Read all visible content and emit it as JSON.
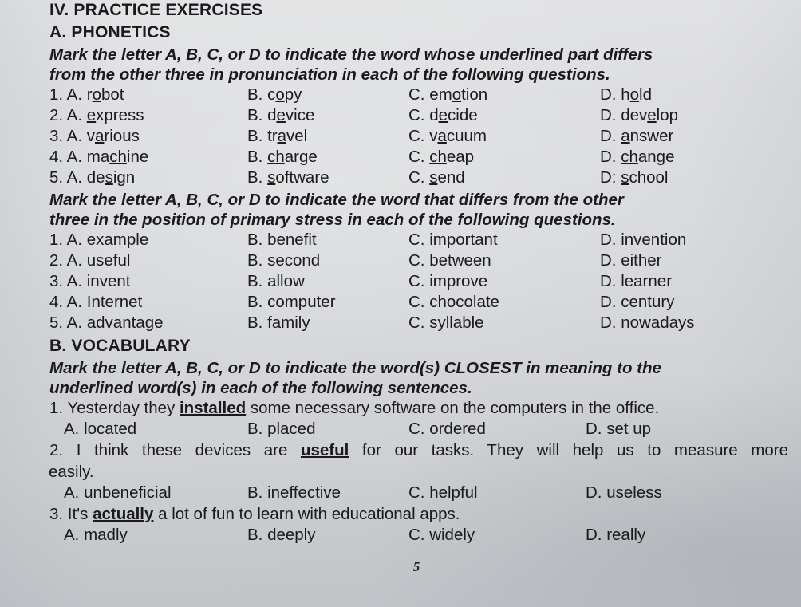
{
  "section": {
    "number_title": "IV. PRACTICE EXERCISES",
    "part_a": "A. PHONETICS",
    "part_b": "B. VOCABULARY"
  },
  "instructions": {
    "pronunciation": {
      "line1": "Mark the letter A, B, C, or D to indicate the word whose underlined part differs",
      "line2": "from the other three in pronunciation in each of the following questions."
    },
    "stress": {
      "line1": "Mark the letter A, B, C, or D to indicate the word that differs from the other",
      "line2": "three in the position of primary stress in each of the following questions."
    },
    "vocabulary": {
      "line1": "Mark the letter A, B, C, or D to indicate the word(s) CLOSEST in meaning to the",
      "line2": "underlined word(s) in each of the following sentences."
    }
  },
  "pronunciation_questions": [
    {
      "number": "1.",
      "options": [
        {
          "label": "A.",
          "pre": "r",
          "mark": "o",
          "post": "bot"
        },
        {
          "label": "B.",
          "pre": "c",
          "mark": "o",
          "post": "py"
        },
        {
          "label": "C.",
          "pre": "em",
          "mark": "o",
          "post": "tion"
        },
        {
          "label": "D.",
          "pre": "h",
          "mark": "o",
          "post": "ld"
        }
      ]
    },
    {
      "number": "2.",
      "options": [
        {
          "label": "A.",
          "pre": "",
          "mark": "e",
          "post": "xpress"
        },
        {
          "label": "B.",
          "pre": "d",
          "mark": "e",
          "post": "vice"
        },
        {
          "label": "C.",
          "pre": "d",
          "mark": "e",
          "post": "cide"
        },
        {
          "label": "D.",
          "pre": "dev",
          "mark": "e",
          "post": "lop"
        }
      ]
    },
    {
      "number": "3.",
      "options": [
        {
          "label": "A.",
          "pre": "v",
          "mark": "a",
          "post": "rious"
        },
        {
          "label": "B.",
          "pre": "tr",
          "mark": "a",
          "post": "vel"
        },
        {
          "label": "C.",
          "pre": "v",
          "mark": "a",
          "post": "cuum"
        },
        {
          "label": "D.",
          "pre": "",
          "mark": "a",
          "post": "nswer"
        }
      ]
    },
    {
      "number": "4.",
      "options": [
        {
          "label": "A.",
          "pre": "ma",
          "mark": "ch",
          "post": "ine"
        },
        {
          "label": "B.",
          "pre": "",
          "mark": "ch",
          "post": "arge"
        },
        {
          "label": "C.",
          "pre": "",
          "mark": "ch",
          "post": "eap"
        },
        {
          "label": "D.",
          "pre": "",
          "mark": "ch",
          "post": "ange"
        }
      ]
    },
    {
      "number": "5.",
      "options": [
        {
          "label": "A.",
          "pre": "de",
          "mark": "s",
          "post": "ign"
        },
        {
          "label": "B.",
          "pre": "",
          "mark": "s",
          "post": "oftware"
        },
        {
          "label": "C.",
          "pre": "",
          "mark": "s",
          "post": "end"
        },
        {
          "label": "D:",
          "pre": "",
          "mark": "s",
          "post": "chool"
        }
      ]
    }
  ],
  "stress_questions": [
    {
      "number": "1.",
      "options": [
        {
          "label": "A.",
          "word": "example"
        },
        {
          "label": "B.",
          "word": "benefit"
        },
        {
          "label": "C.",
          "word": "important"
        },
        {
          "label": "D.",
          "word": "invention"
        }
      ]
    },
    {
      "number": "2.",
      "options": [
        {
          "label": "A.",
          "word": "useful"
        },
        {
          "label": "B.",
          "word": "second"
        },
        {
          "label": "C.",
          "word": "between"
        },
        {
          "label": "D.",
          "word": "either"
        }
      ]
    },
    {
      "number": "3.",
      "options": [
        {
          "label": "A.",
          "word": "invent"
        },
        {
          "label": "B.",
          "word": "allow"
        },
        {
          "label": "C.",
          "word": "improve"
        },
        {
          "label": "D.",
          "word": "learner"
        }
      ]
    },
    {
      "number": "4.",
      "options": [
        {
          "label": "A.",
          "word": "Internet"
        },
        {
          "label": "B.",
          "word": "computer"
        },
        {
          "label": "C.",
          "word": "chocolate"
        },
        {
          "label": "D.",
          "word": "century"
        }
      ]
    },
    {
      "number": "5.",
      "options": [
        {
          "label": "A.",
          "word": "advantage"
        },
        {
          "label": "B.",
          "word": "family"
        },
        {
          "label": "C.",
          "word": "syllable"
        },
        {
          "label": "D.",
          "word": "nowadays"
        }
      ]
    }
  ],
  "vocabulary_questions": [
    {
      "number": "1.",
      "sentence_pre": "Yesterday they ",
      "sentence_key": "installed",
      "sentence_post": " some necessary software on the computers in the office.",
      "sentence_wrap": "",
      "options": [
        {
          "label": "A.",
          "word": "located"
        },
        {
          "label": "B.",
          "word": "placed"
        },
        {
          "label": "C.",
          "word": "ordered"
        },
        {
          "label": "D.",
          "word": "set up"
        }
      ]
    },
    {
      "number": "2.",
      "sentence_pre": "I think these devices are ",
      "sentence_key": "useful",
      "sentence_post": " for our tasks. They will help us to measure more",
      "sentence_wrap": "easily.",
      "options": [
        {
          "label": "A.",
          "word": "unbeneficial"
        },
        {
          "label": "B.",
          "word": "ineffective"
        },
        {
          "label": "C.",
          "word": "helpful"
        },
        {
          "label": "D.",
          "word": "useless"
        }
      ]
    },
    {
      "number": "3.",
      "sentence_pre": "It's ",
      "sentence_key": "actually",
      "sentence_post": " a lot of fun to learn with educational apps.",
      "sentence_wrap": "",
      "options": [
        {
          "label": "A.",
          "word": "madly"
        },
        {
          "label": "B.",
          "word": "deeply"
        },
        {
          "label": "C.",
          "word": "widely"
        },
        {
          "label": "D.",
          "word": "really"
        }
      ]
    }
  ],
  "page_number": "5"
}
